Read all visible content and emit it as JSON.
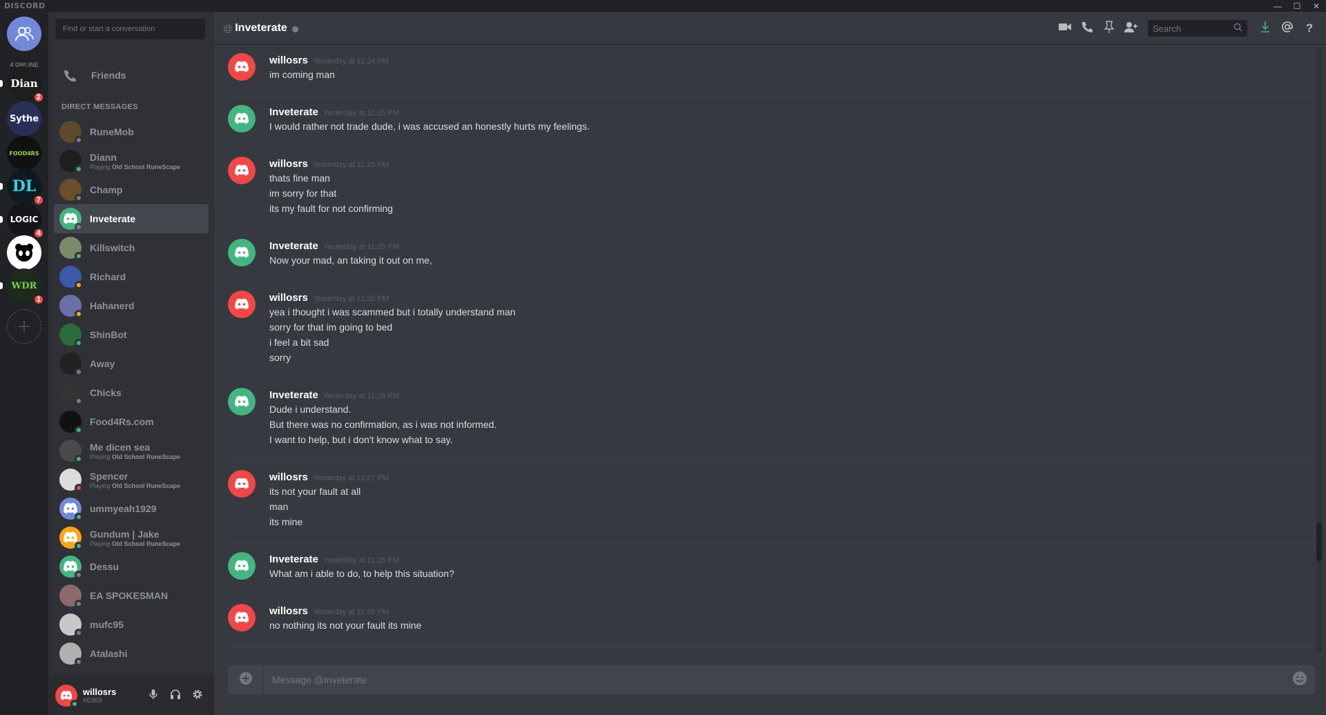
{
  "app": {
    "brand": "DISCORD"
  },
  "window_controls": {
    "minimize": "—",
    "maximize": "☐",
    "close": "✕"
  },
  "guilds": {
    "online_count": "4 ONLINE",
    "items": [
      {
        "label": "Dian",
        "badge": "2",
        "color": "#1e1e1e"
      },
      {
        "label": "Sythe",
        "badge": "",
        "color": "#2a2f5a"
      },
      {
        "label": "FOOD4RS",
        "badge": "",
        "color": "#111111"
      },
      {
        "label": "DL",
        "badge": "7",
        "color": "#0c1a22"
      },
      {
        "label": "LOGIC",
        "badge": "4",
        "color": "#15161a"
      },
      {
        "label": "",
        "badge": "",
        "color": "#ffffff"
      },
      {
        "label": "WDR",
        "badge": "1",
        "color": "#1f2a1c"
      }
    ]
  },
  "dm_sidebar": {
    "search_placeholder": "Find or start a conversation",
    "friends_label": "Friends",
    "section_header": "DIRECT MESSAGES",
    "items": [
      {
        "name": "RuneMob",
        "activity_prefix": "",
        "activity_game": "",
        "avatar_color": "#5c4a2b",
        "status": "#747f8d",
        "active": false
      },
      {
        "name": "Diann",
        "activity_prefix": "Playing ",
        "activity_game": "Old School RuneScape",
        "avatar_color": "#1e1e1e",
        "status": "#43b581",
        "active": false
      },
      {
        "name": "Champ",
        "activity_prefix": "",
        "activity_game": "",
        "avatar_color": "#6b4e2a",
        "status": "#747f8d",
        "active": false
      },
      {
        "name": "Inveterate",
        "activity_prefix": "",
        "activity_game": "",
        "avatar_color": "#43b581",
        "status": "#747f8d",
        "active": true
      },
      {
        "name": "Killswitch",
        "activity_prefix": "",
        "activity_game": "",
        "avatar_color": "#7a8a6a",
        "status": "#43b581",
        "active": false
      },
      {
        "name": "Richard",
        "activity_prefix": "",
        "activity_game": "",
        "avatar_color": "#3a5aa8",
        "status": "#faa61a",
        "active": false
      },
      {
        "name": "Hahanerd",
        "activity_prefix": "",
        "activity_game": "",
        "avatar_color": "#6a6fa8",
        "status": "#faa61a",
        "active": false
      },
      {
        "name": "ShinBot",
        "activity_prefix": "",
        "activity_game": "",
        "avatar_color": "#2c6b3a",
        "status": "#43b581",
        "active": false
      },
      {
        "name": "Away",
        "activity_prefix": "",
        "activity_game": "",
        "avatar_color": "#222222",
        "status": "#747f8d",
        "active": false
      },
      {
        "name": "Chicks",
        "activity_prefix": "",
        "activity_game": "",
        "avatar_color": "#333333",
        "status": "#747f8d",
        "active": false
      },
      {
        "name": "Food4Rs.com",
        "activity_prefix": "",
        "activity_game": "",
        "avatar_color": "#111111",
        "status": "#43b581",
        "active": false
      },
      {
        "name": "Me dicen sea",
        "activity_prefix": "Playing ",
        "activity_game": "Old School RuneScape",
        "avatar_color": "#4a4a4a",
        "status": "#43b581",
        "active": false
      },
      {
        "name": "Spencer",
        "activity_prefix": "Playing ",
        "activity_game": "Old School RuneScape",
        "avatar_color": "#dddddd",
        "status": "#f04747",
        "active": false
      },
      {
        "name": "ummyeah1929",
        "activity_prefix": "",
        "activity_game": "",
        "avatar_color": "#7289da",
        "status": "#43b581",
        "active": false
      },
      {
        "name": "Gundum | Jake",
        "activity_prefix": "Playing ",
        "activity_game": "Old School RuneScape",
        "avatar_color": "#faa61a",
        "status": "#43b581",
        "active": false
      },
      {
        "name": "Dessu",
        "activity_prefix": "",
        "activity_game": "",
        "avatar_color": "#43b581",
        "status": "#747f8d",
        "active": false
      },
      {
        "name": "EA SPOKESMAN",
        "activity_prefix": "",
        "activity_game": "",
        "avatar_color": "#8a6a6a",
        "status": "#747f8d",
        "active": false
      },
      {
        "name": "mufc95",
        "activity_prefix": "",
        "activity_game": "",
        "avatar_color": "#c8c8c8",
        "status": "#747f8d",
        "active": false
      },
      {
        "name": "Atalashi",
        "activity_prefix": "",
        "activity_game": "",
        "avatar_color": "#b0b0b0",
        "status": "#747f8d",
        "active": false
      }
    ]
  },
  "user_panel": {
    "username": "willosrs",
    "discriminator": "#6369"
  },
  "chat_header": {
    "at": "@",
    "title": "Inveterate",
    "search_placeholder": "Search"
  },
  "messages": [
    {
      "author": "willosrs",
      "timestamp": "Yesterday at 11:24 PM",
      "avatar_color": "#f04747",
      "lines": [
        "im coming man"
      ]
    },
    {
      "author": "Inveterate",
      "timestamp": "Yesterday at 11:25 PM",
      "avatar_color": "#43b581",
      "lines": [
        "I would rather not trade dude, i was  accused an honestly hurts my feelings."
      ]
    },
    {
      "author": "willosrs",
      "timestamp": "Yesterday at 11:25 PM",
      "avatar_color": "#f04747",
      "lines": [
        "thats fine man",
        "im sorry for that",
        "its my fault for not confirming"
      ]
    },
    {
      "author": "Inveterate",
      "timestamp": "Yesterday at 11:25 PM",
      "avatar_color": "#43b581",
      "lines": [
        "Now your mad, an taking it out on me,"
      ]
    },
    {
      "author": "willosrs",
      "timestamp": "Yesterday at 11:25 PM",
      "avatar_color": "#f04747",
      "lines": [
        "yea i thought i was scammed but i totally understand man",
        "sorry for that im going to bed",
        "i feel a bit sad",
        "sorry"
      ]
    },
    {
      "author": "Inveterate",
      "timestamp": "Yesterday at 11:26 PM",
      "avatar_color": "#43b581",
      "lines": [
        "Dude i understand.",
        "But there was no confirmation, as i was not informed.",
        "I want to help, but i don't know what to say."
      ]
    },
    {
      "author": "willosrs",
      "timestamp": "Yesterday at 11:27 PM",
      "avatar_color": "#f04747",
      "lines": [
        "its not your fault at all",
        "man",
        "its mine"
      ]
    },
    {
      "author": "Inveterate",
      "timestamp": "Yesterday at 11:28 PM",
      "avatar_color": "#43b581",
      "lines": [
        "What am i able to do, to help this situation?"
      ]
    },
    {
      "author": "willosrs",
      "timestamp": "Yesterday at 11:28 PM",
      "avatar_color": "#f04747",
      "lines": [
        "no nothing its not your fault its mine"
      ]
    }
  ],
  "composer": {
    "placeholder": "Message @Inveterate"
  }
}
